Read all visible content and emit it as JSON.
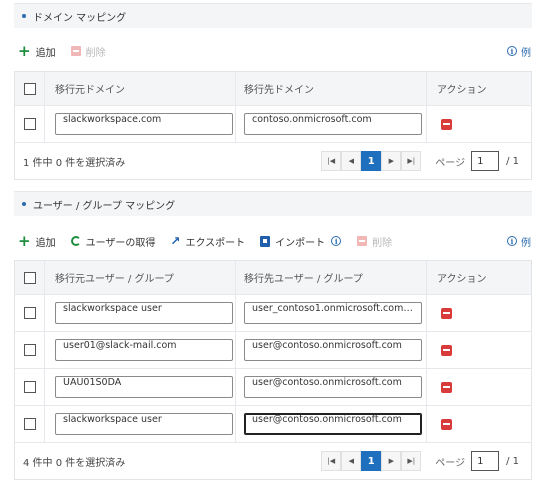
{
  "domain_section": {
    "title": "ドメイン マッピング",
    "toolbar": {
      "add": "追加",
      "delete": "削除",
      "example": "例"
    },
    "columns": {
      "source": "移行元ドメイン",
      "target": "移行先ドメイン",
      "action": "アクション"
    },
    "rows": [
      {
        "source": "slackworkspace.com",
        "target": "contoso.onmicrosoft.com"
      }
    ],
    "footer": {
      "selection": "1 件中 0 件を選択済み",
      "page_label": "ページ",
      "current_page": "1",
      "page_input": "1",
      "total": "/ 1",
      "first": "|◀",
      "prev": "◀",
      "next": "▶",
      "last": "▶|"
    }
  },
  "user_section": {
    "title": "ユーザー / グループ マッピング",
    "toolbar": {
      "add": "追加",
      "fetch": "ユーザーの取得",
      "export": "エクスポート",
      "import": "インポート",
      "delete": "削除",
      "example": "例"
    },
    "columns": {
      "source": "移行元ユーザー / グループ",
      "target": "移行先ユーザー / グループ",
      "action": "アクション"
    },
    "rows": [
      {
        "source": "slackworkspace user",
        "target": "user_contoso1.onmicrosoft.com#E..."
      },
      {
        "source": "user01@slack-mail.com",
        "target": "user@contoso.onmicrosoft.com"
      },
      {
        "source": "UAU01S0DA",
        "target": "user@contoso.onmicrosoft.com"
      },
      {
        "source": "slackworkspace user",
        "target": "user@contoso.onmicrosoft.com"
      }
    ],
    "footer": {
      "selection": "4 件中 0 件を選択済み",
      "page_label": "ページ",
      "current_page": "1",
      "page_input": "1",
      "total": "/ 1",
      "first": "|◀",
      "prev": "◀",
      "next": "▶",
      "last": "▶|"
    }
  },
  "colors": {
    "accent": "#1f6fbf",
    "add_green": "#1e8e3e",
    "delete_red": "#d93a3a",
    "header_bg": "#f4f5f7"
  },
  "icons": {
    "info": "i"
  }
}
